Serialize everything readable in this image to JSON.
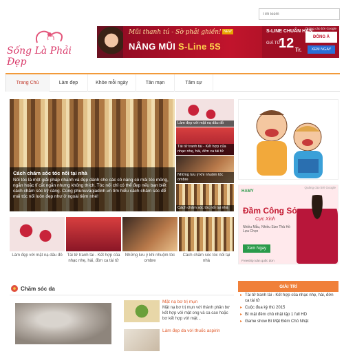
{
  "search": {
    "placeholder": "Tìm kiếm"
  },
  "logo": {
    "text": "Sống Là Phải Đẹp"
  },
  "banner": {
    "tagline": "Mũi thanh tú - Sờ phải ghiền!",
    "headline_pre": "NÂNG MŨI ",
    "headline_brand": "S-Line 5S",
    "right_title": "S-LINE CHUẨN HÀN",
    "price_prefix": "GIÁ TỪ",
    "price": "12",
    "price_unit": "Tr.",
    "new_badge": "NEW",
    "ad_by": "Quảng cáo bởi Google",
    "brand_logo": "ĐÔNG Á",
    "cta": "XEM NGAY"
  },
  "nav": {
    "items": [
      {
        "label": "Trang Chủ",
        "active": true
      },
      {
        "label": "Làm đẹp",
        "active": false
      },
      {
        "label": "Khỏe mỗi ngày",
        "active": false
      },
      {
        "label": "Tản mạn",
        "active": false
      },
      {
        "label": "Tâm sự",
        "active": false
      }
    ]
  },
  "hero": {
    "title": "Cách chăm sóc tóc nối tại nhà",
    "desc": "Nối tóc là một giải pháp nhanh và đẹp dành cho các cô nàng có mái tóc mỏng, ngắn hoặc tỉ cắt ngắn nhưng không thích. Tóc nối chỉ có thể đẹp nếu bạn biết cách chăm sóc kỹ càng. Cùng phunuvagiadinh.vn tìm hiểu cách chăm sóc để mái tóc nối luôn đẹp như ở ngoài tiệm nhé!"
  },
  "side_items": [
    {
      "caption": "Làm đẹp với mặt nạ dâu đỏ"
    },
    {
      "caption": "Tái tử tranh tài - Kết hợp của nhạc nhẹ, hài, đờn ca tài tử"
    },
    {
      "caption": "Những lưu ý khi nhuộm tóc ombre"
    },
    {
      "caption": "Cách chăm sóc tóc nối tại nhà"
    }
  ],
  "ad2": {
    "brand": "Đầm Công Sở",
    "title": "Đầm Công Sở",
    "subtitle": "Cực Xinh",
    "body": "Nhiều Mẫu, Nhiều Size Thả Hồ Lựa Chọn",
    "cta": "Xem Ngay",
    "ad_by": "Quảng cáo bởi Google",
    "footer": "Freeship toàn quốc đơn"
  },
  "row_items": [
    {
      "caption": "Làm đẹp với mặt nạ dâu đỏ"
    },
    {
      "caption": "Tái tử tranh tài - Kết hợp của nhạc nhẹ, hài, đờn ca tài tử"
    },
    {
      "caption": "Những lưu ý khi nhuộm tóc ombre"
    },
    {
      "caption": "Cách chăm sóc tóc nối tại nhà"
    }
  ],
  "section": {
    "title": "Chăm sóc da"
  },
  "news": [
    {
      "title": "Mặt nạ bơ trị mụn",
      "desc": "Mặt nạ bơ trị mụn với thành phần bơ kết hợp với mật ong và ca cao hoặc bơ kết hợp với mật..."
    },
    {
      "title": "Làm đẹp da với thuốc aspirin",
      "desc": ""
    }
  ],
  "giai_tri": {
    "heading": "GIẢI TRÍ",
    "items": [
      "Tái tử tranh tài - Kết hợp của nhạc nhẹ, hài, đờn ca tài tử",
      "Cuộc đua kỳ thú 2015",
      "Bí mật đêm chủ nhật tập 1 full HD",
      "Game show Bí Mật Đêm Chủ Nhật"
    ]
  }
}
